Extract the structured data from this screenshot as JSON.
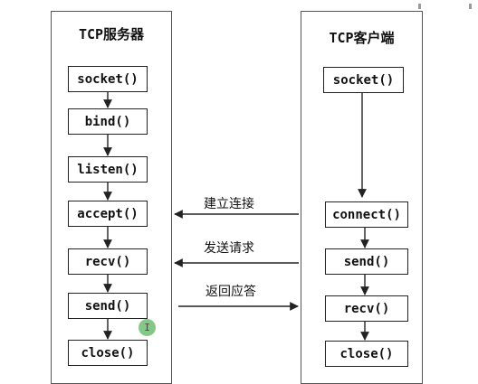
{
  "server": {
    "title": "TCP服务器",
    "steps": [
      "socket()",
      "bind()",
      "listen()",
      "accept()",
      "recv()",
      "send()",
      "close()"
    ]
  },
  "client": {
    "title": "TCP客户端",
    "steps": [
      "socket()",
      "connect()",
      "send()",
      "recv()",
      "close()"
    ]
  },
  "messages": {
    "connect": "建立连接",
    "request": "发送请求",
    "response": "返回应答"
  },
  "cursor": {
    "glyph": "I",
    "icon": "text-cursor-icon"
  },
  "colors": {
    "line": "#222222",
    "cursor": "#6fbf73"
  }
}
